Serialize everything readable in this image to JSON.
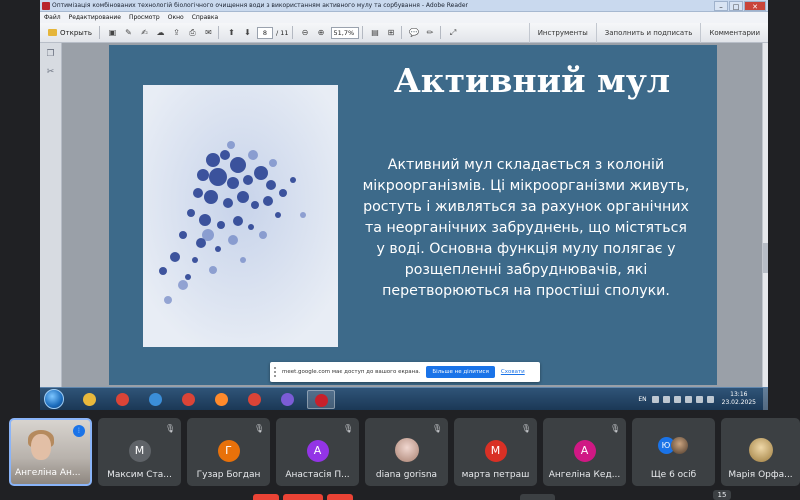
{
  "window": {
    "title": "Оптимізація комбінованих технологій біологічного очищення води з використанням активного мулу та сорбування - Adobe Reader",
    "controls": [
      "–",
      "□",
      "✕"
    ]
  },
  "menu": [
    "Файл",
    "Редактирование",
    "Просмотр",
    "Окно",
    "Справка"
  ],
  "toolbar": {
    "open_label": "Открыть",
    "page_current": "8",
    "page_total": "/ 11",
    "zoom": "51,7%",
    "right_tabs": [
      "Инструменты",
      "Заполнить и подписать",
      "Комментарии"
    ]
  },
  "slide": {
    "title": "Активний мул",
    "body": "Активний мул складається з колоній мікроорганізмів. Ці мікроорганізми живуть, ростуть і живляться за рахунок органічних та неорганічних забруднень, що містяться у воді. Основна функція мулу полягає у розщепленні забруднювачів, які перетворюються на простіші сполуки.",
    "photo_colors": {
      "bg": "#d9e2f0",
      "cluster": "#1e3a8a"
    }
  },
  "share_notice": {
    "text": "meet.google.com має доступ до вашого екрана.",
    "stop_label": "Більше не ділитися",
    "hide_label": "Сховати"
  },
  "taskbar": {
    "language": "EN",
    "time": "13:16",
    "date": "23.02.2025",
    "apps": [
      {
        "name": "explorer-icon",
        "color": "#e8b83c"
      },
      {
        "name": "chrome-icon",
        "color": "#db4437"
      },
      {
        "name": "ie-icon",
        "color": "#3b8ed8"
      },
      {
        "name": "chrome-icon",
        "color": "#db4437"
      },
      {
        "name": "firefox-icon",
        "color": "#ff8a2b"
      },
      {
        "name": "chrome-icon",
        "color": "#db4437"
      },
      {
        "name": "viber-icon",
        "color": "#7b5cd6"
      },
      {
        "name": "adobe-reader-icon",
        "color": "#c8202b"
      }
    ]
  },
  "participants": {
    "self_name": "Ангеліна Ан...",
    "tiles": [
      {
        "initial": "М",
        "name": "Максим Ста...",
        "color": "#5f6368"
      },
      {
        "initial": "Г",
        "name": "Гузар Богдан",
        "color": "#e8710a"
      },
      {
        "initial": "А",
        "name": "Анастасія П...",
        "color": "#9334e6"
      },
      {
        "initial": "",
        "name": "diana gorisna",
        "color": "#c98f8f"
      },
      {
        "initial": "М",
        "name": "марта петраш",
        "color": "#d93025"
      },
      {
        "initial": "А",
        "name": "Ангеліна Кед...",
        "color": "#d01884"
      }
    ],
    "more_label": "Ще 6 осіб",
    "more_initial": "Ю",
    "last_name": "Марія Орфа...",
    "count": "15"
  }
}
